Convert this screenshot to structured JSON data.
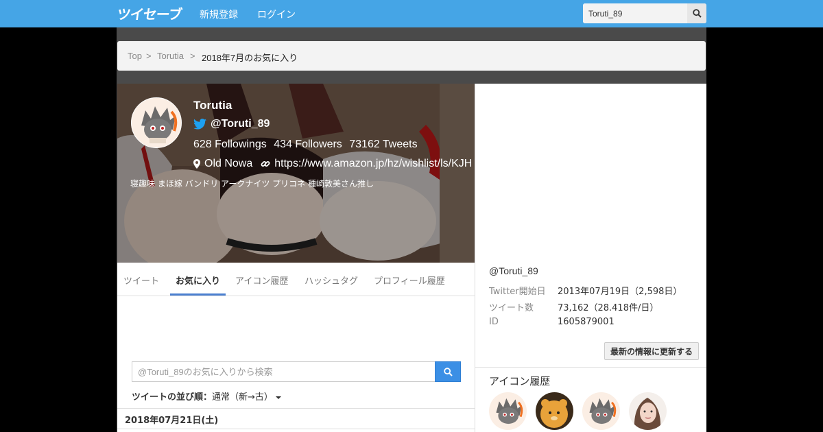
{
  "navbar": {
    "logo_text": "ツイセーブ",
    "signup_label": "新規登録",
    "login_label": "ログイン",
    "search_value": "Toruti_89"
  },
  "breadcrumb": {
    "top": "Top",
    "sep": ">",
    "user": "Torutia",
    "current": "2018年7月のお気に入り"
  },
  "profile": {
    "name": "Torutia",
    "handle": "@Toruti_89",
    "followings": "628 Followings",
    "followers": "434 Followers",
    "tweets": "73162 Tweets",
    "location": "Old Nowa",
    "url": "https://www.amazon.jp/hz/wishlist/ls/KJH",
    "bio": "寝趣味 まほ嫁 バンドリ アークナイツ プリコネ 種崎敦美さん推し"
  },
  "tabs": [
    {
      "label": "ツイート"
    },
    {
      "label": "お気に入り"
    },
    {
      "label": "アイコン履歴"
    },
    {
      "label": "ハッシュタグ"
    },
    {
      "label": "プロフィール履歴"
    }
  ],
  "favorites": {
    "search_placeholder": "@Toruti_89のお気に入りから検索",
    "sort_label": "ツイートの並び順：",
    "sort_value": "通常（新→古）",
    "date_header": "2018年07月21日(土)"
  },
  "sidebar": {
    "handle": "@Toruti_89",
    "start_label": "Twitter開始日",
    "start_value": "2013年07月19日（2,598日）",
    "tweets_label": "ツイート数",
    "tweets_value": "73,162（28.418件/日）",
    "id_label": "ID",
    "id_value": "1605879001",
    "update_label": "最新の情報に更新する",
    "icon_history_title": "アイコン履歴"
  },
  "colors": {
    "navbar": "#45a5e6",
    "accent": "#3b8fe5",
    "tab_underline": "#4a7fd0",
    "twitter_blue": "#1da1f2"
  }
}
